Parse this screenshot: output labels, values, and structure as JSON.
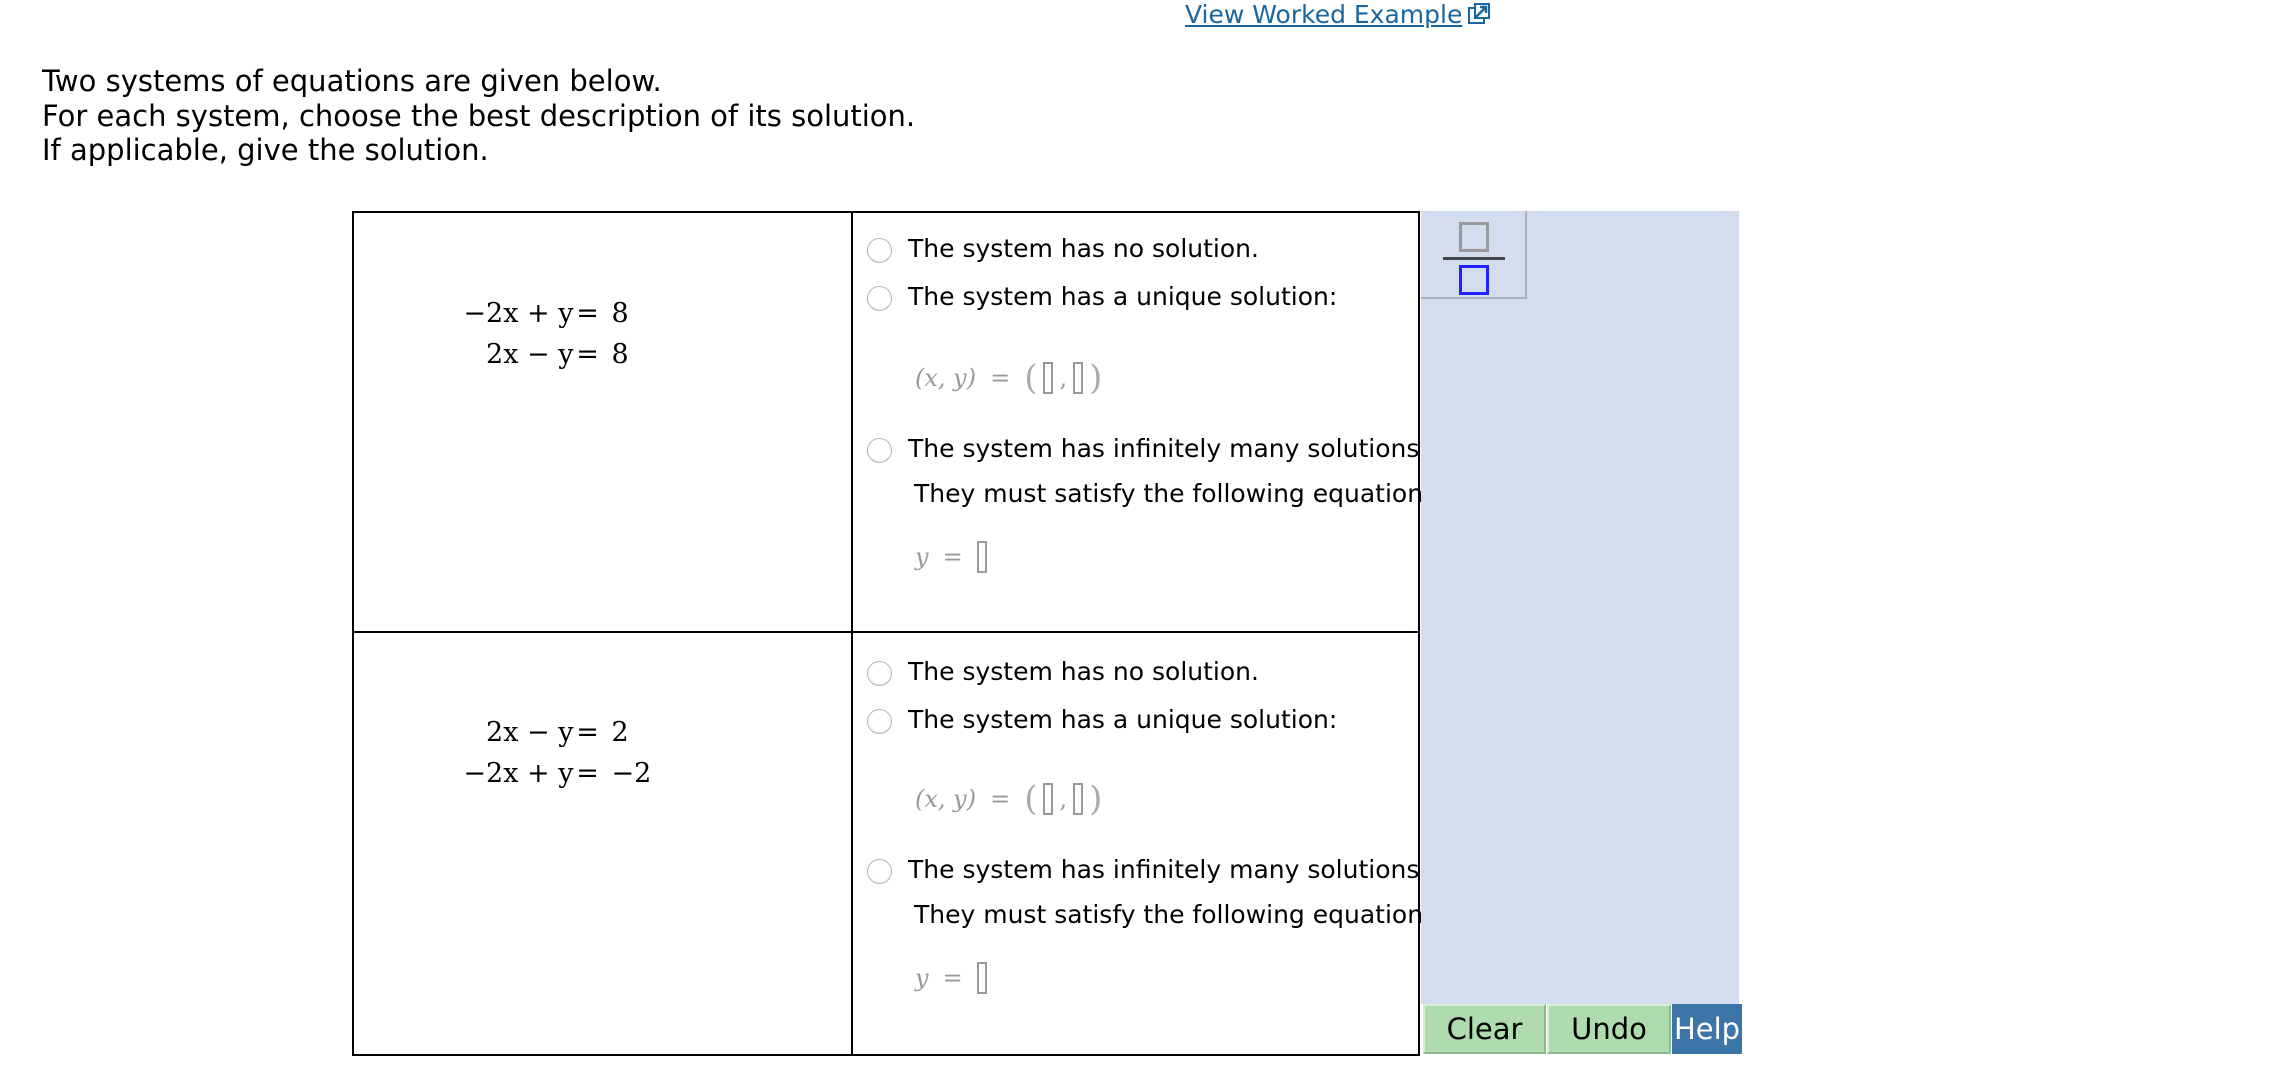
{
  "header": {
    "worked_example_link": "View Worked Example",
    "link_icon": "external-link-icon"
  },
  "instructions": [
    "Two systems of equations are given below.",
    "For each system, choose the best description of its solution.",
    "If applicable, give the solution."
  ],
  "systems": [
    {
      "equations": [
        {
          "lhs": "−2x + y",
          "rhs": "8"
        },
        {
          "lhs": "2x − y",
          "rhs": "8"
        }
      ],
      "options": {
        "no_solution": "The system has no solution.",
        "unique": "The system has a unique solution:",
        "unique_lhs": "(x, y)",
        "infinite": "The system has infinitely many solutions.",
        "infinite_sub": "They must satisfy the following equation:",
        "infinite_lhs": "y",
        "equals": "="
      },
      "selected": null,
      "inputs": {
        "x": "",
        "y": "",
        "y_equation": ""
      }
    },
    {
      "equations": [
        {
          "lhs": "2x − y",
          "rhs": "2"
        },
        {
          "lhs": "−2x + y",
          "rhs": "−2"
        }
      ],
      "options": {
        "no_solution": "The system has no solution.",
        "unique": "The system has a unique solution:",
        "unique_lhs": "(x, y)",
        "infinite": "The system has infinitely many solutions.",
        "infinite_sub": "They must satisfy the following equation:",
        "infinite_lhs": "y",
        "equals": "="
      },
      "selected": null,
      "inputs": {
        "x": "",
        "y": "",
        "y_equation": ""
      }
    }
  ],
  "palette": {
    "fraction_button": "fraction-icon"
  },
  "buttons": {
    "clear": "Clear",
    "undo": "Undo",
    "help": "Help"
  },
  "colors": {
    "link": "#1a66a0",
    "palette_bg": "#d4ddee",
    "green_button": "#aedcaf",
    "help_button": "#3c75a7"
  }
}
